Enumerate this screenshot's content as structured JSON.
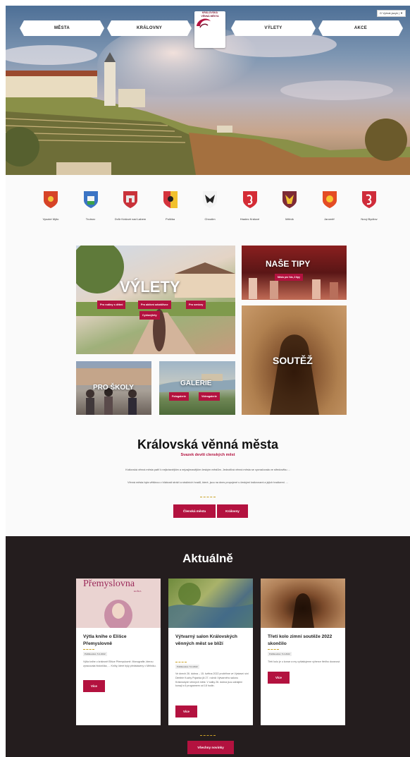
{
  "header": {
    "nav": [
      "MĚSTA",
      "KRÁLOVNY",
      "VÝLETY",
      "AKCE"
    ],
    "logo_line1": "KRÁLOVSKÁ",
    "logo_line2": "VĚNNÁ MĚSTA",
    "lang_label": "G  Vybrat jazyk | ▼"
  },
  "cities": [
    {
      "name": "Vysoké Mýto"
    },
    {
      "name": "Trutnov"
    },
    {
      "name": "Dvůr Králové nad Labem"
    },
    {
      "name": "Polička"
    },
    {
      "name": "Chrudim"
    },
    {
      "name": "Hradec Králové"
    },
    {
      "name": "Mělník"
    },
    {
      "name": "Jaroměř"
    },
    {
      "name": "Nový Bydžov"
    }
  ],
  "tiles": {
    "vylety": {
      "title": "VÝLETY",
      "pills": [
        "Pro rodiny s dětmi",
        "Pro aktivní odvážlivce",
        "Pro seniory",
        "Cyklovýlety"
      ]
    },
    "tipy": {
      "title": "NAŠE TIPY",
      "pill": "Město pro Vás, 3 tipy"
    },
    "skoly": {
      "title": "PRO ŠKOLY"
    },
    "galerie": {
      "title": "GALERIE",
      "pills": [
        "Fotogalerie",
        "Videogalerie"
      ]
    },
    "soutez": {
      "title": "SOUTĚŽ"
    }
  },
  "about": {
    "title": "Královská věnná města",
    "subtitle": "Svazek devíti clenských měst",
    "p1": "Královská věnná města patří k nejkrásnějším a nejzajímavějším českým městům. Jednotlivá věnná města se vyznačovala ve středověku ...",
    "p2": "Věnná města byla většinou v blízkosti stráží a strážních hradů, které, jsou na dnes propojené s českými královnami a jejich tradicemi. ...",
    "buttons": [
      "Členská města",
      "Královny"
    ]
  },
  "news": {
    "title": "Aktuálně",
    "cards": [
      {
        "img_text": "Přemyslovna",
        "img_sub": "ELIŠKA",
        "title": "Výtla knihe o Elišce Přemyslovně",
        "date": "Publikováno: 5.4.2022",
        "text": "Výtla knihe o královně Elišce Přemyslovně. Monografie, kterou zpracovala historička, ... Knihy, které byly představeny v Mělníku.",
        "button": "Více"
      },
      {
        "title": "Výtvarný salon Královských věnných měst se blíží",
        "date": "Publikováno: 5.4.2022",
        "text": "Ve dnech 26. dubna – 15. května 2022 proběhne ve Výstavní síni Dimitrie Kuchy Pojanka již 27. ročník Výtvarného salonu Královských věnných měst. V sálky 26. dubna jsou zahájení konají s 6 programem od 18 hodin.",
        "button": "Více"
      },
      {
        "title": "Třetí kolo zimní soutěže 2022 skončilo",
        "date": "Publikováno: 5.4.2022",
        "text": "Třetí kolo je u konce a my vyhlašujeme výherce třetího doosnovi.",
        "button": "Více"
      }
    ],
    "all_button": "Všechny novinky"
  }
}
